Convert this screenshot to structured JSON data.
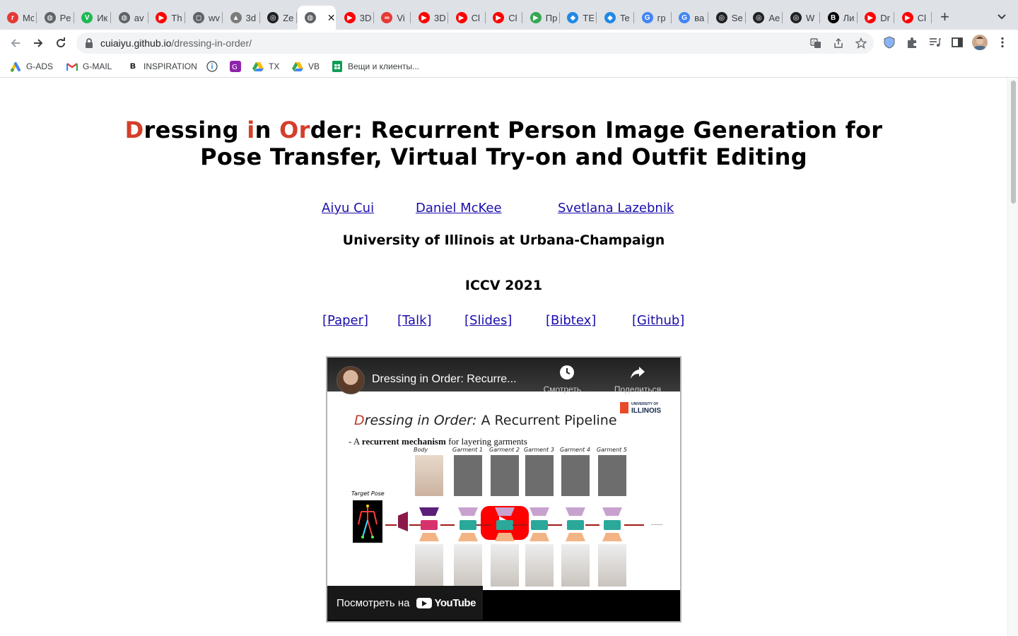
{
  "browser": {
    "tabs": [
      {
        "title": "Mc",
        "icon": "red-circle-logo-icon",
        "color": "#e53935"
      },
      {
        "title": "Pe",
        "icon": "globe-icon",
        "color": "#5f6368"
      },
      {
        "title": "Ик",
        "icon": "vuetify-logo-icon",
        "color": "#1db954"
      },
      {
        "title": "av",
        "icon": "globe-icon",
        "color": "#5f6368"
      },
      {
        "title": "Th",
        "icon": "youtube-icon",
        "color": "#ff0000"
      },
      {
        "title": "wv",
        "icon": "instagram-icon",
        "color": "#5f6368"
      },
      {
        "title": "3d",
        "icon": "triangle-logo-icon",
        "color": "#7c7c7c"
      },
      {
        "title": "Ze",
        "icon": "spiral-logo-icon",
        "color": "#202124"
      },
      {
        "title": "",
        "icon": "globe-icon",
        "color": "#5f6368",
        "active": true
      },
      {
        "title": "3D",
        "icon": "youtube-icon",
        "color": "#ff0000"
      },
      {
        "title": "Vi",
        "icon": "rings-logo-icon",
        "color": "#e53935"
      },
      {
        "title": "3D",
        "icon": "youtube-icon",
        "color": "#ff0000"
      },
      {
        "title": "Cl",
        "icon": "youtube-icon",
        "color": "#ff0000"
      },
      {
        "title": "Cl",
        "icon": "youtube-icon",
        "color": "#ff0000"
      },
      {
        "title": "Пр",
        "icon": "google-play-icon",
        "color": "#34a853"
      },
      {
        "title": "TE",
        "icon": "cube-icon",
        "color": "#1e88e5"
      },
      {
        "title": "Te",
        "icon": "cube-icon",
        "color": "#1e88e5"
      },
      {
        "title": "гр",
        "icon": "google-icon",
        "color": "#4285f4"
      },
      {
        "title": "ва",
        "icon": "google-icon",
        "color": "#4285f4"
      },
      {
        "title": "Se",
        "icon": "chatgpt-icon",
        "color": "#202124"
      },
      {
        "title": "Ae",
        "icon": "chatgpt-icon",
        "color": "#202124"
      },
      {
        "title": "W",
        "icon": "chatgpt-icon",
        "color": "#202124"
      },
      {
        "title": "Ли",
        "icon": "behance-icon",
        "color": "#000000"
      },
      {
        "title": "Dr",
        "icon": "youtube-icon",
        "color": "#ff0000"
      },
      {
        "title": "Cl",
        "icon": "youtube-icon",
        "color": "#ff0000"
      }
    ],
    "url_host": "cuiaiyu.github.io",
    "url_path": "/dressing-in-order/",
    "bookmarks": [
      {
        "label": "G-ADS",
        "icon": "google-ads-icon"
      },
      {
        "label": "G-MAIL",
        "icon": "gmail-icon"
      },
      {
        "label": "INSPIRATION",
        "icon": "behance-icon"
      },
      {
        "label": "",
        "icon": "info-circle-icon"
      },
      {
        "label": "",
        "icon": "purple-app-icon"
      },
      {
        "label": "TX",
        "icon": "google-drive-icon"
      },
      {
        "label": "VB",
        "icon": "google-drive-icon"
      },
      {
        "label": "Вещи и клиенты...",
        "icon": "google-sheets-icon"
      }
    ]
  },
  "page": {
    "title_parts": [
      {
        "text": "D",
        "red": true
      },
      {
        "text": "ressing ",
        "red": false
      },
      {
        "text": "i",
        "red": true
      },
      {
        "text": "n ",
        "red": false
      },
      {
        "text": "Or",
        "red": true
      },
      {
        "text": "der: Recurrent Person Image Generation for Pose Transfer, Virtual Try-on and Outfit Editing",
        "red": false
      }
    ],
    "authors": [
      "Aiyu Cui",
      "Daniel McKee",
      "Svetlana Lazebnik"
    ],
    "affiliation": "University of Illinois at Urbana-Champaign",
    "venue": "ICCV 2021",
    "links": [
      "[Paper]",
      "[Talk]",
      "[Slides]",
      "[Bibtex]",
      "[Github]"
    ],
    "video": {
      "title": "Dressing in Order: Recurre...",
      "watch_later": "Смотреть ...",
      "share": "Поделиться",
      "watch_on": "Посмотреть на",
      "youtube": "YouTube",
      "slide_title_a": "Dressing in Order:",
      "slide_title_b": " A Recurrent Pipeline",
      "slide_sub_a": "- A ",
      "slide_sub_b": "recurrent mechanism",
      "slide_sub_c": " for layering garments",
      "uiuc_small": "UNIVERSITY OF",
      "uiuc_big": "ILLINOIS",
      "target_pose": "Target Pose",
      "garment_labels": [
        "Body",
        "Garment 1",
        "Garment 2",
        "Garment 3",
        "Garment 4",
        "Garment 5"
      ],
      "dots": "......"
    }
  }
}
